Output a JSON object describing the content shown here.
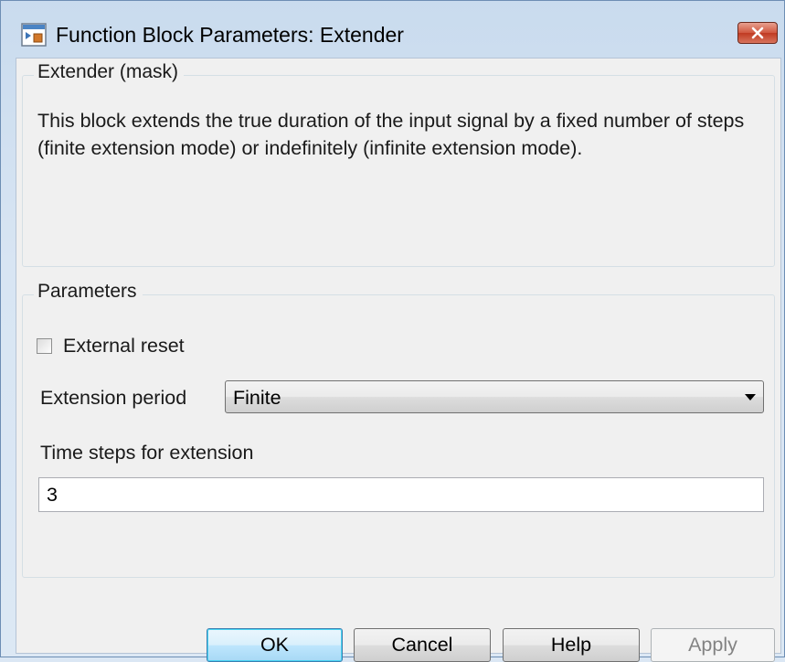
{
  "window": {
    "title": "Function Block Parameters: Extender",
    "app_icon": "simulink-block-icon",
    "close_icon": "close-icon"
  },
  "mask": {
    "legend": "Extender (mask)",
    "description": "This block extends the true duration of the input signal by a fixed number of steps (finite extension mode) or indefinitely (infinite extension mode)."
  },
  "parameters": {
    "legend": "Parameters",
    "external_reset": {
      "label": "External reset",
      "checked": false
    },
    "extension_period": {
      "label": "Extension period",
      "selected": "Finite"
    },
    "time_steps": {
      "label": "Time steps for extension",
      "value": "3"
    }
  },
  "buttons": {
    "ok": "OK",
    "cancel": "Cancel",
    "help": "Help",
    "apply": "Apply"
  },
  "colors": {
    "close_button": "#c7452d",
    "default_button": "#a7d9f5",
    "window_frame": "#dbe7f4"
  }
}
